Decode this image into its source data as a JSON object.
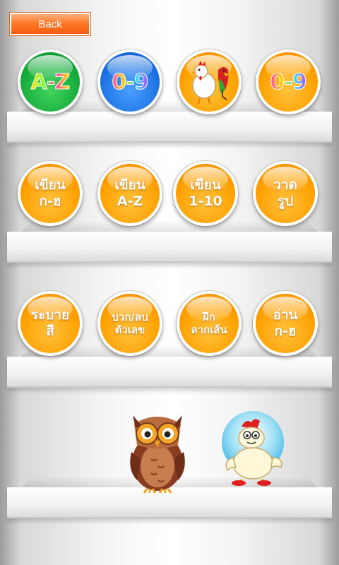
{
  "header": {
    "back_label": "Back"
  },
  "shelf1": {
    "items": [
      {
        "label": "A-Z",
        "icon": "alphabet-az-icon"
      },
      {
        "label": "0-9",
        "icon": "numbers-09-icon"
      },
      {
        "label": "",
        "icon": "chicken-parrot-icon"
      },
      {
        "label": "0-9",
        "icon": "numbers-09-icon"
      }
    ]
  },
  "shelf2": {
    "items": [
      {
        "label": "เขียน\nก-ฮ"
      },
      {
        "label": "เขียน\nA-Z"
      },
      {
        "label": "เขียน\n1-10"
      },
      {
        "label": "วาด\nรูป"
      }
    ]
  },
  "shelf3": {
    "items": [
      {
        "label": "ระบาย\nสี"
      },
      {
        "label": "บวก/ลบ\nตัวเลข"
      },
      {
        "label": "ฝึก\nลากเส้น"
      },
      {
        "label": "อ่าน\nก-ฮ"
      }
    ]
  },
  "characters": [
    {
      "icon": "owl-icon"
    },
    {
      "icon": "chicken-icon"
    }
  ],
  "colors": {
    "button_orange": "#ffa000",
    "button_green": "#14a83a",
    "button_blue": "#1a6fe0",
    "back_button": "#ff7a2a"
  }
}
